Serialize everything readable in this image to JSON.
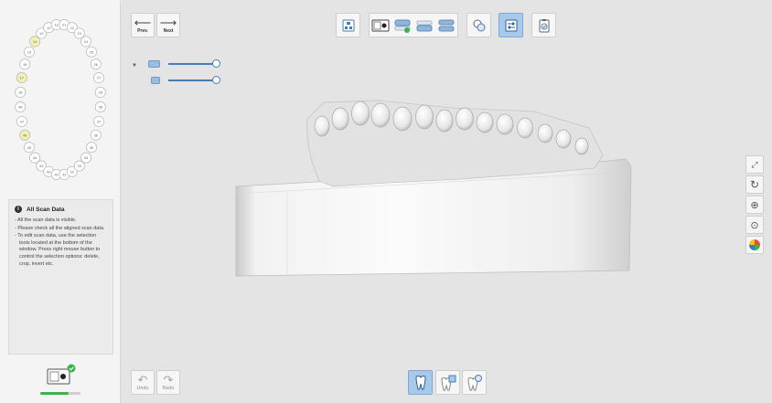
{
  "nav": {
    "prev_label": "Prev.",
    "next_label": "Next",
    "undo_label": "Undo",
    "redo_label": "Redo"
  },
  "toolbar": {
    "buttons": [
      "scan-stage-icon",
      "scanner-view-icon",
      "upper-jaw-icon",
      "lower-jaw-icon",
      "occlusion-icon",
      "alignment-icon",
      "data-settings-icon",
      "checklist-icon"
    ],
    "active": "data-settings-icon"
  },
  "tooth_chart": {
    "upper_numbers": [
      "18",
      "17",
      "16",
      "15",
      "14",
      "13",
      "12",
      "11",
      "21",
      "22",
      "23",
      "24",
      "25",
      "26",
      "27",
      "28"
    ],
    "lower_numbers": [
      "48",
      "47",
      "46",
      "45",
      "44",
      "43",
      "42",
      "41",
      "31",
      "32",
      "33",
      "34",
      "35",
      "36",
      "37",
      "38"
    ],
    "highlighted": [
      "14",
      "17",
      "46"
    ]
  },
  "info": {
    "title": "All Scan Data",
    "items": [
      "- All the scan data is visible.",
      "- Please check all the aligned scan data.",
      "- To edit scan data, use the selection tools located at the bottom of the window. Press right mouse button to control the selection options: delete, crop, invert etc."
    ]
  },
  "scanner": {
    "progress_fraction": 0.7
  },
  "colors": {
    "accent": "#4a7cb4",
    "active_bg": "#a9c9ea",
    "success": "#3eb24a",
    "highlight_tooth": "#f3f0b4"
  },
  "side_tools": [
    "fit-icon",
    "reset-view-icon",
    "zoom-in-icon",
    "zoom-icon",
    "color-wheel-icon"
  ],
  "bottom_tools": [
    "tooth-select-icon",
    "tooth-edit-icon",
    "tooth-auto-icon"
  ]
}
